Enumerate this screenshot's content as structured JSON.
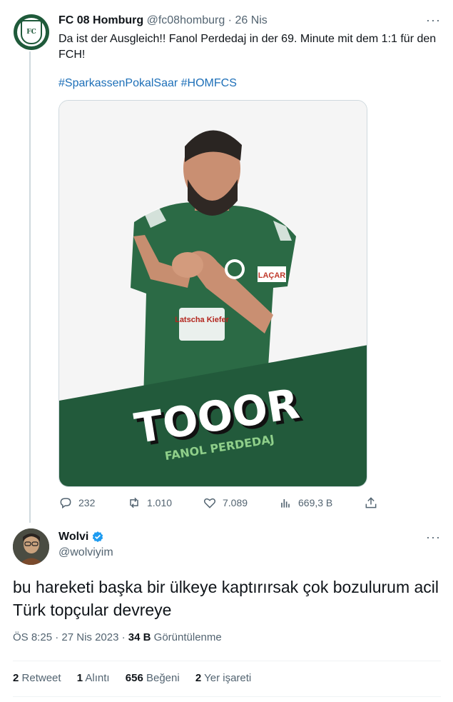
{
  "tweet1": {
    "author_name": "FC 08 Homburg",
    "handle": "@fc08homburg",
    "separator": "·",
    "date": "26 Nis",
    "more": "···",
    "text": "Da ist der Ausgleich!! Fanol Perdedaj in der 69. Minute mit dem 1:1 für den FCH!",
    "hashtags": "#SparkassenPokalSaar #HOMFCS",
    "image": {
      "headline": "TOOOR",
      "player_name": "FANOL PERDEDAJ",
      "sponsor": "Latscha Kiefer",
      "sleeve": "LAÇAR"
    },
    "actions": {
      "replies": "232",
      "retweets": "1.010",
      "likes": "7.089",
      "views": "669,3 B"
    }
  },
  "tweet2": {
    "author_name": "Wolvi",
    "handle": "@wolviyim",
    "more": "···",
    "text": "bu hareketi başka bir ülkeye kaptırırsak çok bozulurum acil Türk topçular devreye",
    "time": "ÖS 8:25",
    "date": "27 Nis 2023",
    "views_count": "34 B",
    "views_label": "Görüntülenme",
    "stats": {
      "retweets_count": "2",
      "retweets_label": "Retweet",
      "quotes_count": "1",
      "quotes_label": "Alıntı",
      "likes_count": "656",
      "likes_label": "Beğeni",
      "bookmarks_count": "2",
      "bookmarks_label": "Yer işareti"
    }
  },
  "colors": {
    "brand_green": "#1f5a3a",
    "link_blue": "#1d6fb8",
    "verified_blue": "#1d9bf0",
    "muted": "#536471"
  }
}
